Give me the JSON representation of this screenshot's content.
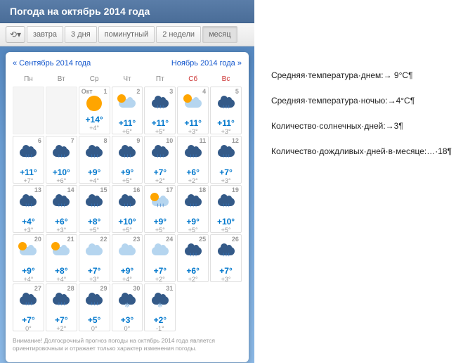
{
  "header": {
    "title": "Погода на октябрь 2014 года"
  },
  "tabs": {
    "clock": "⟲▾",
    "items": [
      "завтра",
      "3 дня",
      "поминутный",
      "2 недели",
      "месяц"
    ],
    "active": 4
  },
  "nav": {
    "prev": "« Сентябрь 2014 года",
    "next": "Ноябрь 2014 года »"
  },
  "dow": [
    "Пн",
    "Вт",
    "Ср",
    "Чт",
    "Пт",
    "Сб",
    "Вс"
  ],
  "monthLabel": "Окт",
  "days": [
    {
      "d": 1,
      "hi": "+14°",
      "lo": "+4°",
      "i": "sun"
    },
    {
      "d": 2,
      "hi": "+11°",
      "lo": "+6°",
      "i": "pc"
    },
    {
      "d": 3,
      "hi": "+11°",
      "lo": "+5°",
      "i": "rain"
    },
    {
      "d": 4,
      "hi": "+11°",
      "lo": "+3°",
      "i": "pc"
    },
    {
      "d": 5,
      "hi": "+11°",
      "lo": "+3°",
      "i": "rain"
    },
    {
      "d": 6,
      "hi": "+11°",
      "lo": "+7°",
      "i": "rain"
    },
    {
      "d": 7,
      "hi": "+10°",
      "lo": "+6°",
      "i": "rain"
    },
    {
      "d": 8,
      "hi": "+9°",
      "lo": "+4°",
      "i": "rain"
    },
    {
      "d": 9,
      "hi": "+9°",
      "lo": "+5°",
      "i": "rain"
    },
    {
      "d": 10,
      "hi": "+7°",
      "lo": "+2°",
      "i": "rain"
    },
    {
      "d": 11,
      "hi": "+6°",
      "lo": "+2°",
      "i": "rain"
    },
    {
      "d": 12,
      "hi": "+7°",
      "lo": "+3°",
      "i": "rain"
    },
    {
      "d": 13,
      "hi": "+4°",
      "lo": "+3°",
      "i": "rain"
    },
    {
      "d": 14,
      "hi": "+6°",
      "lo": "+3°",
      "i": "rain"
    },
    {
      "d": 15,
      "hi": "+8°",
      "lo": "+5°",
      "i": "rain"
    },
    {
      "d": 16,
      "hi": "+10°",
      "lo": "+5°",
      "i": "rain"
    },
    {
      "d": 17,
      "hi": "+9°",
      "lo": "+5°",
      "i": "rain-pc"
    },
    {
      "d": 18,
      "hi": "+9°",
      "lo": "+5°",
      "i": "rain"
    },
    {
      "d": 19,
      "hi": "+10°",
      "lo": "+5°",
      "i": "rain"
    },
    {
      "d": 20,
      "hi": "+9°",
      "lo": "+4°",
      "i": "pc"
    },
    {
      "d": 21,
      "hi": "+8°",
      "lo": "+4°",
      "i": "pc"
    },
    {
      "d": 22,
      "hi": "+7°",
      "lo": "+3°",
      "i": "cloud"
    },
    {
      "d": 23,
      "hi": "+9°",
      "lo": "+4°",
      "i": "cloud"
    },
    {
      "d": 24,
      "hi": "+7°",
      "lo": "+2°",
      "i": "cloud"
    },
    {
      "d": 25,
      "hi": "+6°",
      "lo": "+2°",
      "i": "rain"
    },
    {
      "d": 26,
      "hi": "+7°",
      "lo": "+3°",
      "i": "rain"
    },
    {
      "d": 27,
      "hi": "+7°",
      "lo": "0°",
      "i": "rain"
    },
    {
      "d": 28,
      "hi": "+7°",
      "lo": "+2°",
      "i": "rain"
    },
    {
      "d": 29,
      "hi": "+5°",
      "lo": "0°",
      "i": "rain"
    },
    {
      "d": 30,
      "hi": "+3°",
      "lo": "0°",
      "i": "snow"
    },
    {
      "d": 31,
      "hi": "+2°",
      "lo": "-1°",
      "i": "snow"
    }
  ],
  "emptyBefore": 2,
  "disclaimer": "Внимание! Долгосрочный прогноз погоды на октябрь 2014 года является ориентировочным и отражает только характер изменения погоды.",
  "stats": [
    "Средняя·температура·днем:→ 9°С¶",
    "Средняя·температура·ночью:→4°С¶",
    "Количество·солнечных·дней:→3¶",
    "Количество·дождливых·дней·в·месяце:…·18¶"
  ]
}
